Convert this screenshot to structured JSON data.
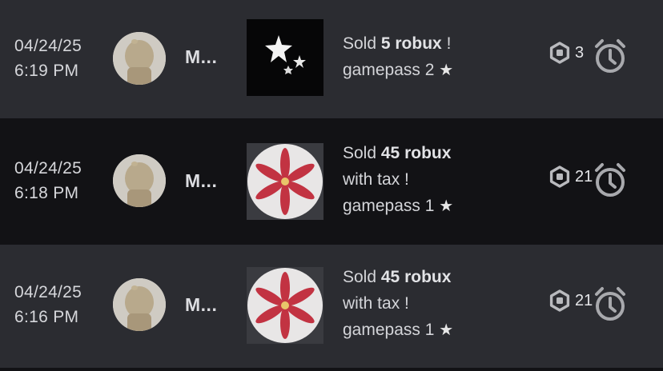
{
  "rows": [
    {
      "date": "04/24/25",
      "time": "6:19 PM",
      "user": "M...",
      "thumbnail": "stars-icon",
      "line1_prefix": "Sold ",
      "amount_text": "5 robux",
      "line1_suffix": " !",
      "line2": "",
      "gamepass": "gamepass 2",
      "robux": "3"
    },
    {
      "date": "04/24/25",
      "time": "6:18 PM",
      "user": "M...",
      "thumbnail": "lily-flower",
      "line1_prefix": "Sold ",
      "amount_text": "45 robux",
      "line1_suffix": "",
      "line2": "with tax !",
      "gamepass": "gamepass 1",
      "robux": "21"
    },
    {
      "date": "04/24/25",
      "time": "6:16 PM",
      "user": "M...",
      "thumbnail": "lily-flower",
      "line1_prefix": "Sold ",
      "amount_text": "45 robux",
      "line1_suffix": "",
      "line2": "with tax !",
      "gamepass": "gamepass 1",
      "robux": "21"
    }
  ],
  "star_glyph": "★",
  "colors": {
    "row_light": "#2b2c31",
    "row_dark": "#121215",
    "text": "#d4d5d9",
    "icon": "#b9babe"
  }
}
